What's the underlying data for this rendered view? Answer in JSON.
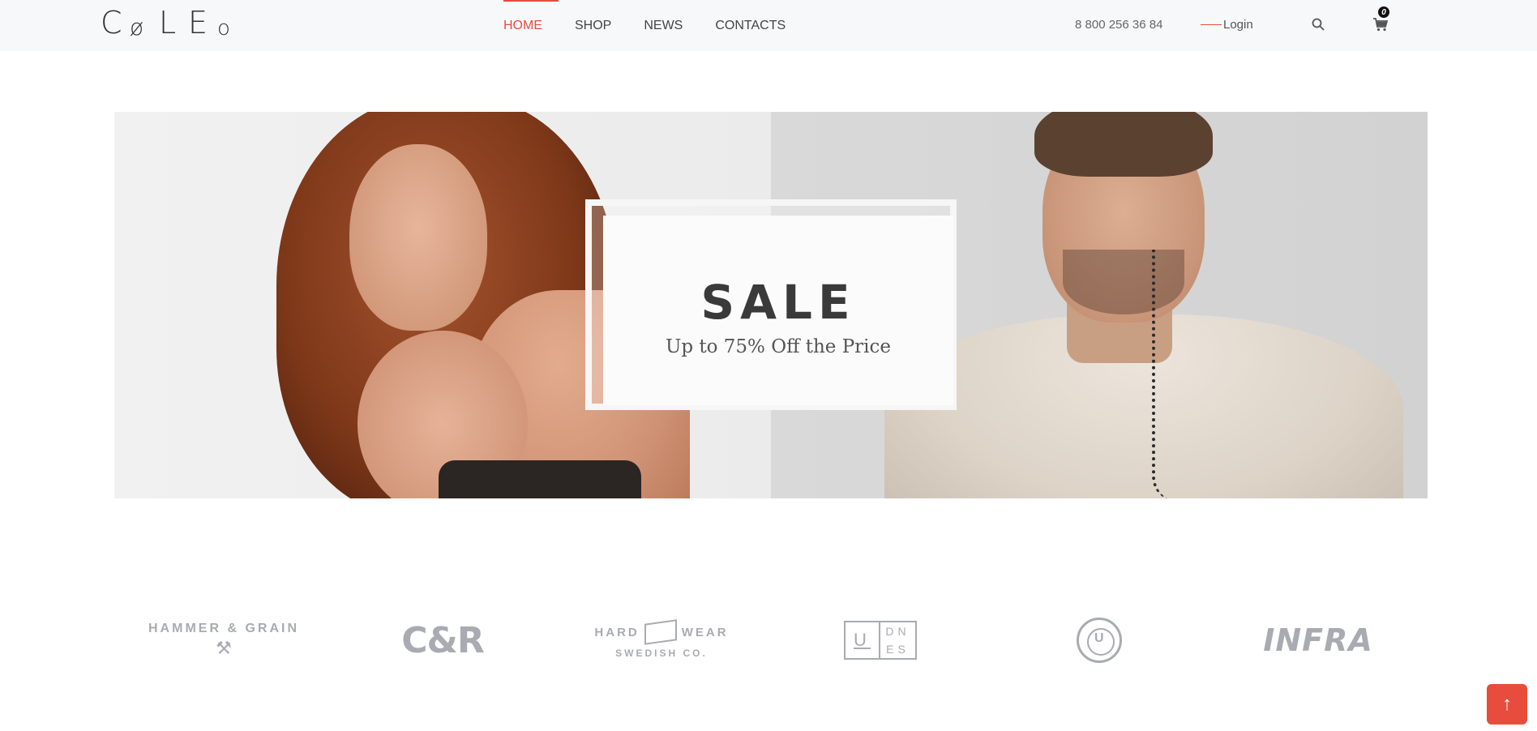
{
  "logo": {
    "letters": [
      "C",
      "ø",
      "L",
      "E",
      "o"
    ]
  },
  "nav": {
    "items": [
      {
        "label": "HOME",
        "active": true
      },
      {
        "label": "SHOP",
        "active": false
      },
      {
        "label": "NEWS",
        "active": false
      },
      {
        "label": "CONTACTS",
        "active": false
      }
    ]
  },
  "header": {
    "phone": "8 800 256 36 84",
    "login_label": "Login",
    "cart_count": "0",
    "icons": {
      "search": "search-icon",
      "cart": "cart-icon"
    }
  },
  "banner": {
    "title": "SALE",
    "subtitle": "Up to 75% Off the Price"
  },
  "brands": [
    {
      "name": "HAMMER & GRAIN"
    },
    {
      "name": "C&R"
    },
    {
      "name": "HARD",
      "name2": "WEAR",
      "sub": "SWEDISH CO."
    },
    {
      "letters": [
        "U",
        "DN",
        "ES"
      ]
    },
    {
      "name": "circle-u-logo"
    },
    {
      "name": "INFRA"
    }
  ],
  "back_to_top": {
    "icon": "arrow-up-icon",
    "glyph": "↑"
  },
  "colors": {
    "accent": "#e84c3d",
    "header_bg": "#f7f8fa",
    "brand_gray": "#a9abb2"
  }
}
